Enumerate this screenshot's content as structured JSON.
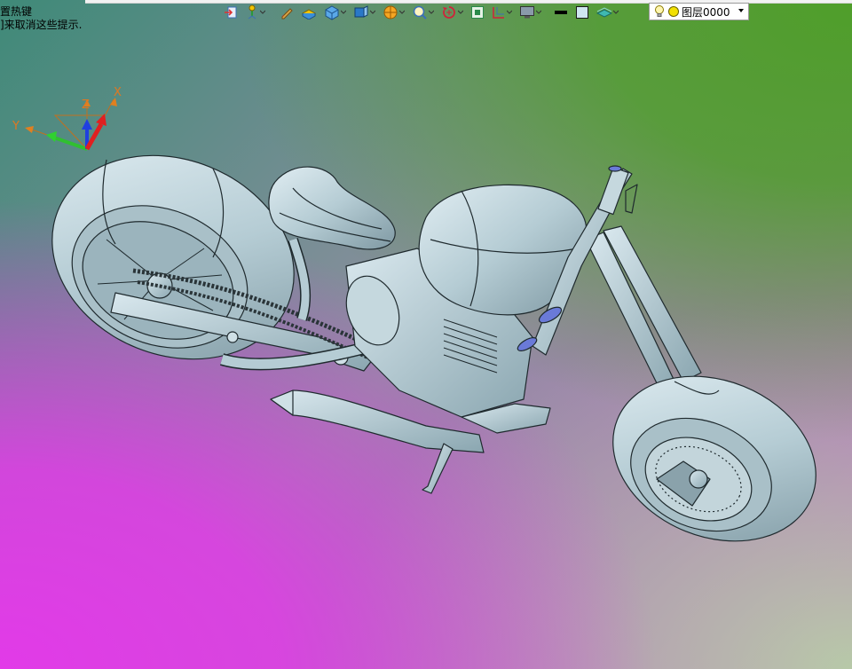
{
  "viewport": {
    "hint_line1": "置热键",
    "hint_line2": "]来取消这些提示.",
    "colors": {
      "bg_top_right": "#4f9e2a",
      "bg_bottom_left": "#e23ae8",
      "model_fill": "#b5ccd4",
      "model_stroke": "#1f2a2e"
    }
  },
  "axes": {
    "x_label": "X",
    "y_label": "Y",
    "z_label": "Z"
  },
  "toolbar": {
    "items": [
      {
        "icon": "import-icon"
      },
      {
        "icon": "snap-point-icon"
      },
      {
        "icon": "pen-icon"
      },
      {
        "icon": "block-icon"
      },
      {
        "icon": "cube-icon"
      },
      {
        "icon": "view-cube-icon"
      },
      {
        "icon": "render-sphere-icon"
      },
      {
        "icon": "zoom-icon"
      },
      {
        "icon": "rotate-icon"
      },
      {
        "icon": "fit-view-icon"
      },
      {
        "icon": "section-icon"
      },
      {
        "icon": "display-icon"
      },
      {
        "icon": "line-color-icon"
      },
      {
        "icon": "fill-color-icon"
      },
      {
        "icon": "layer-stack-icon"
      }
    ],
    "layer_select": {
      "value": "图层0000"
    }
  }
}
